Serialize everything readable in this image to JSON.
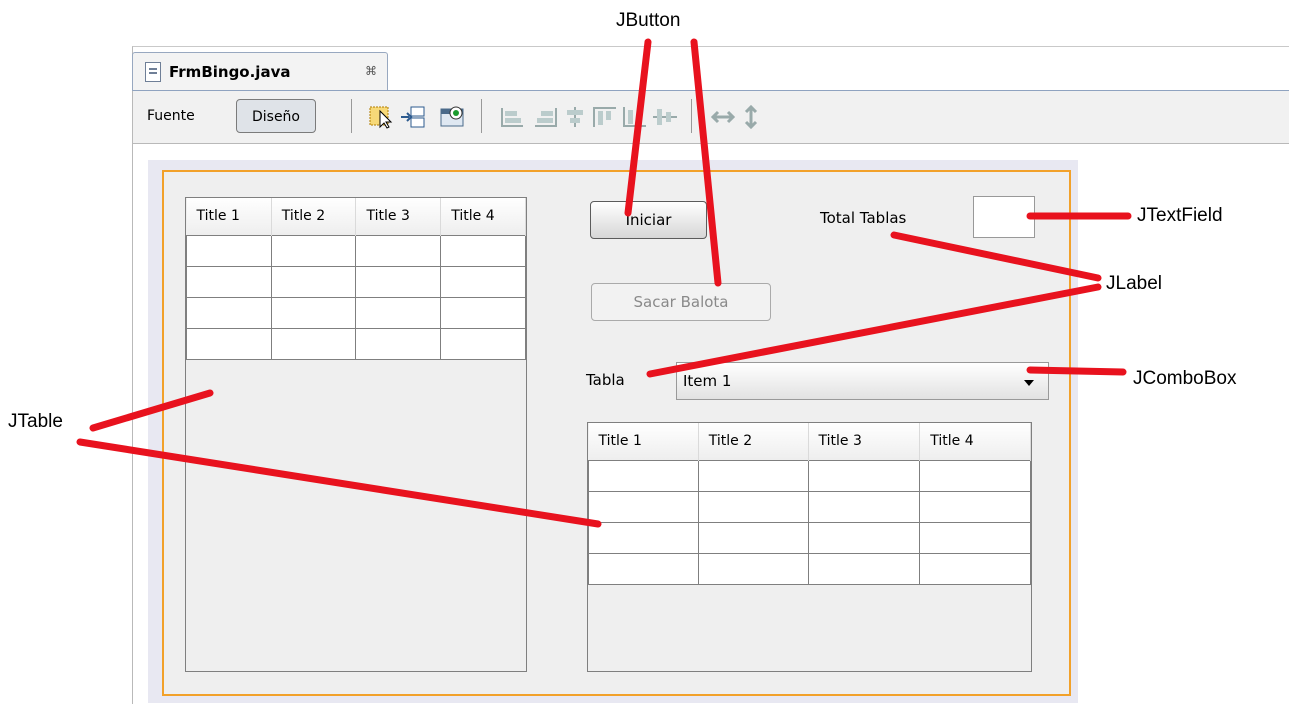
{
  "tab": {
    "title": "FrmBingo.java",
    "close_glyph": "⌘"
  },
  "toolbar": {
    "source_label": "Fuente",
    "design_label": "Diseño"
  },
  "form": {
    "table_left": {
      "headers": [
        "Title 1",
        "Title 2",
        "Title 3",
        "Title 4"
      ],
      "rows": 4
    },
    "table_right": {
      "headers": [
        "Title 1",
        "Title 2",
        "Title 3",
        "Title 4"
      ],
      "rows": 4
    },
    "start_button": "Iniciar",
    "draw_button": "Sacar Balota",
    "total_label": "Total Tablas",
    "total_value": "",
    "table_label": "Tabla",
    "combo_value": "Item 1"
  },
  "annotations": {
    "jbutton": "JButton",
    "jtextfield": "JTextField",
    "jlabel": "JLabel",
    "jcombobox": "JComboBox",
    "jtable": "JTable"
  },
  "colors": {
    "annotation": "#e8121e",
    "form_border": "#f2a12a",
    "design_bg": "#e8e8f2"
  }
}
